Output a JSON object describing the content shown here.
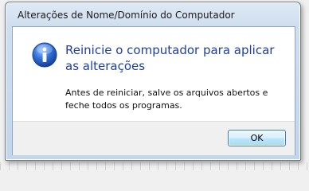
{
  "window": {
    "title": "Alterações de Nome/Domínio do Computador"
  },
  "dialog": {
    "icon": "information-icon",
    "main_instruction": "Reinicie o computador para aplicar as alterações",
    "content": "Antes de reiniciar, salve os arquivos abertos e feche todos os programas."
  },
  "footer": {
    "ok_label": "OK"
  },
  "colors": {
    "instruction_text": "#1e3fa0",
    "icon_blue": "#2a64c6"
  }
}
